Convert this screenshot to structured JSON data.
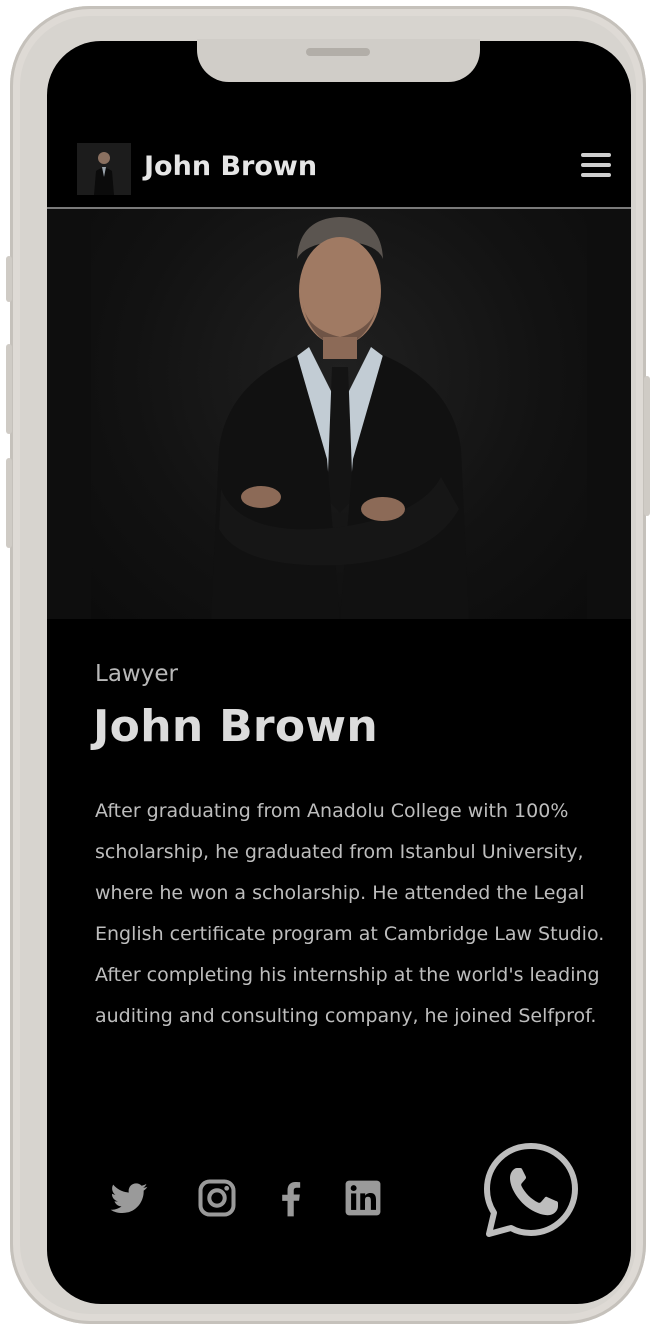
{
  "header": {
    "title": "John Brown"
  },
  "profile": {
    "role": "Lawyer",
    "name": "John Brown",
    "bio": "After graduating from Anadolu College with 100% scholarship, he graduated from Istanbul University, where he won a scholarship. He attended the Legal English certificate program at Cambridge Law Studio. After completing his internship at the world's leading auditing and consulting company, he joined Selfprof."
  },
  "socials": [
    {
      "icon": "twitter-icon"
    },
    {
      "icon": "instagram-icon"
    },
    {
      "icon": "facebook-icon"
    },
    {
      "icon": "linkedin-icon"
    }
  ],
  "colors": {
    "background": "#000000",
    "text": "#bdbdbd",
    "frame": "#d7d4cf"
  }
}
